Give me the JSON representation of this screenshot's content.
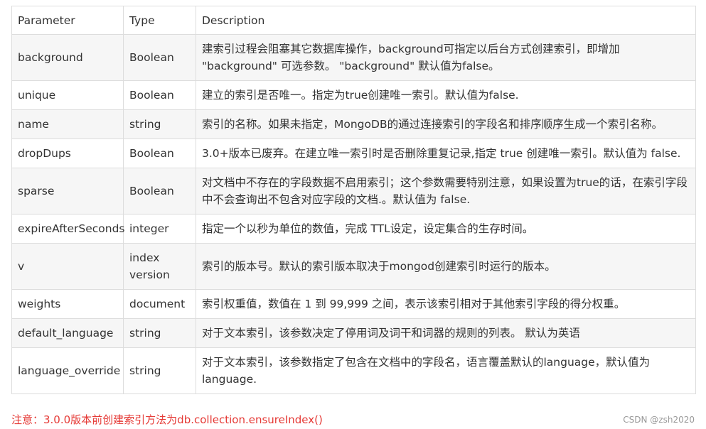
{
  "table": {
    "headers": [
      "Parameter",
      "Type",
      "Description"
    ],
    "rows": [
      {
        "param": "background",
        "type": "Boolean",
        "desc": "建索引过程会阻塞其它数据库操作，background可指定以后台方式创建索引，即增加 \"background\" 可选参数。 \"background\" 默认值为false。"
      },
      {
        "param": "unique",
        "type": "Boolean",
        "desc": "建立的索引是否唯一。指定为true创建唯一索引。默认值为false."
      },
      {
        "param": "name",
        "type": "string",
        "desc": "索引的名称。如果未指定，MongoDB的通过连接索引的字段名和排序顺序生成一个索引名称。"
      },
      {
        "param": "dropDups",
        "type": "Boolean",
        "desc": "3.0+版本已废弃。在建立唯一索引时是否删除重复记录,指定 true 创建唯一索引。默认值为 false."
      },
      {
        "param": "sparse",
        "type": "Boolean",
        "desc": "对文档中不存在的字段数据不启用索引；这个参数需要特别注意，如果设置为true的话，在索引字段中不会查询出不包含对应字段的文档.。默认值为 false."
      },
      {
        "param": "expireAfterSeconds",
        "type": "integer",
        "desc": "指定一个以秒为单位的数值，完成 TTL设定，设定集合的生存时间。"
      },
      {
        "param": "v",
        "type": "index version",
        "desc": "索引的版本号。默认的索引版本取决于mongod创建索引时运行的版本。"
      },
      {
        "param": "weights",
        "type": "document",
        "desc": "索引权重值，数值在 1 到 99,999 之间，表示该索引相对于其他索引字段的得分权重。"
      },
      {
        "param": "default_language",
        "type": "string",
        "desc": "对于文本索引，该参数决定了停用词及词干和词器的规则的列表。 默认为英语"
      },
      {
        "param": "language_override",
        "type": "string",
        "desc": "对于文本索引，该参数指定了包含在文档中的字段名，语言覆盖默认的language，默认值为 language."
      }
    ]
  },
  "note": "注意：3.0.0版本前创建索引方法为db.collection.ensureIndex()",
  "watermark": "CSDN @zsh2020",
  "colors": {
    "border": "#dddddd",
    "stripe": "#f6f6f6",
    "note": "#e53935",
    "text": "#333333"
  }
}
